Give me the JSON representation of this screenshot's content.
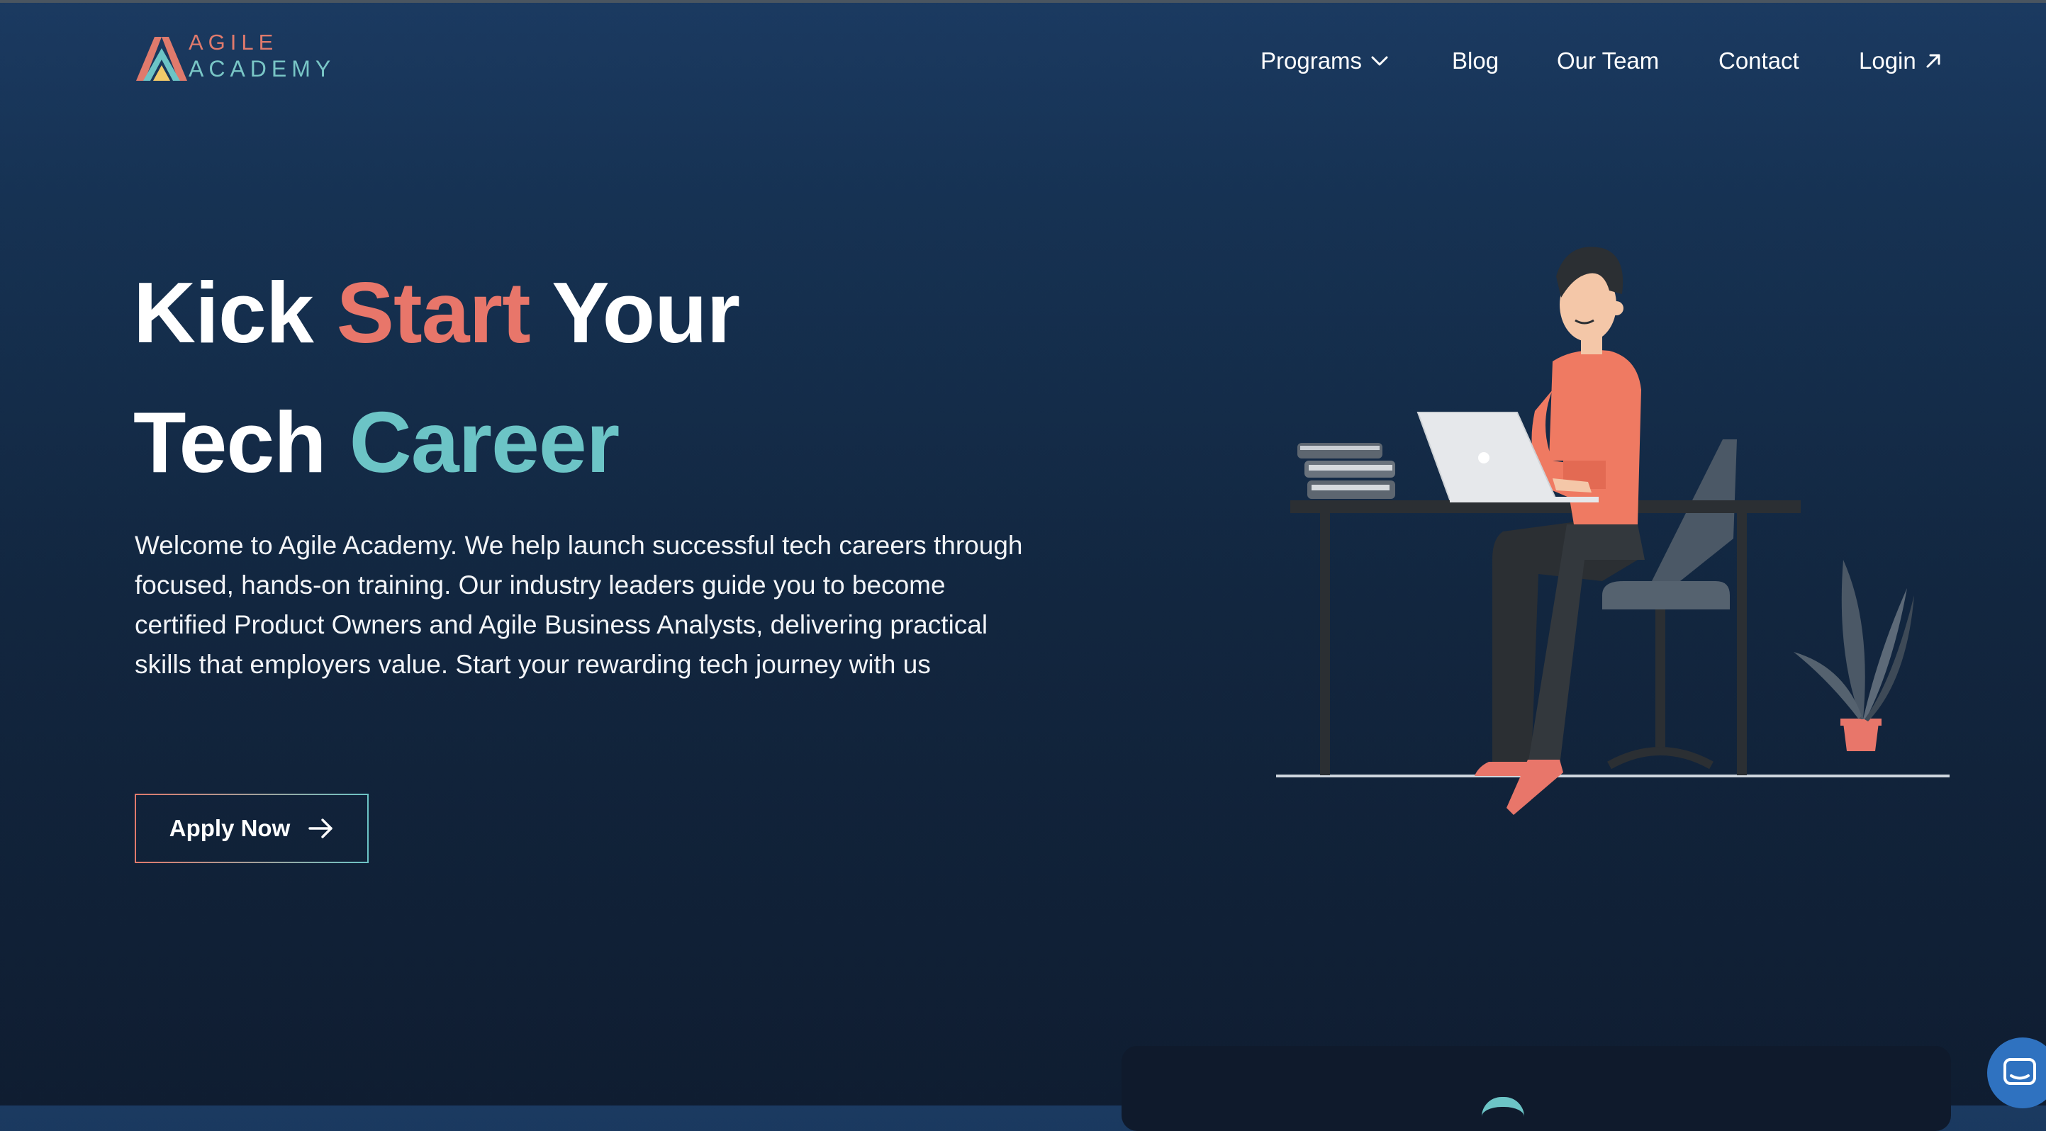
{
  "header": {
    "logo": {
      "line1": "AGILE",
      "line2": "ACADEMY"
    },
    "nav": {
      "programs": "Programs",
      "blog": "Blog",
      "our_team": "Our Team",
      "contact": "Contact",
      "login": "Login"
    }
  },
  "hero": {
    "title_line1": {
      "part1": "Kick ",
      "accent": "Start",
      "part2": " Your"
    },
    "title_line2": {
      "part1": "Tech ",
      "accent": "Career"
    },
    "description": "Welcome to Agile Academy. We help launch successful tech careers through focused, hands-on training. Our industry leaders guide you to become certified Product Owners and Agile Business Analysts, delivering practical skills that employers value. Start your rewarding tech journey with us",
    "cta_label": "Apply Now"
  },
  "colors": {
    "accent_coral": "#e8766a",
    "accent_teal": "#6cc4c6",
    "background_top": "#1b3a61",
    "background_bottom": "#0f1d31",
    "chat_button": "#2f72c0"
  },
  "icons": {
    "programs_dropdown": "chevron-down-icon",
    "login_external": "arrow-up-right-icon",
    "apply": "arrow-right-icon",
    "chat": "chat-icon"
  }
}
